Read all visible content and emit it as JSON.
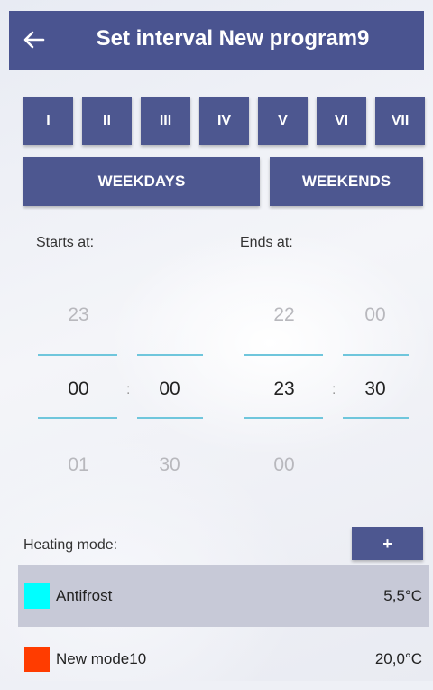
{
  "header": {
    "title": "Set interval New program9"
  },
  "days": [
    "I",
    "II",
    "III",
    "IV",
    "V",
    "VI",
    "VII"
  ],
  "groups": {
    "weekdays": "WEEKDAYS",
    "weekends": "WEEKENDS"
  },
  "labels": {
    "starts_at": "Starts at:",
    "ends_at": "Ends at:",
    "heating_mode": "Heating mode:",
    "add": "+"
  },
  "pickers": {
    "start_hour": {
      "prev": "23",
      "value": "00",
      "next": "01"
    },
    "start_minute": {
      "prev": "",
      "value": "00",
      "next": "30"
    },
    "end_hour": {
      "prev": "22",
      "value": "23",
      "next": "00"
    },
    "end_minute": {
      "prev": "00",
      "value": "30",
      "next": ""
    },
    "separator": ":"
  },
  "modes": [
    {
      "name": "Antifrost",
      "temp": "5,5°C",
      "color": "#00ffff"
    },
    {
      "name": "New mode10",
      "temp": "20,0°C",
      "color": "#ff3c00"
    }
  ],
  "colors": {
    "primary": "#4a5490",
    "accent_line": "#6fc6dc",
    "selected_row": "#c7c9d7"
  }
}
